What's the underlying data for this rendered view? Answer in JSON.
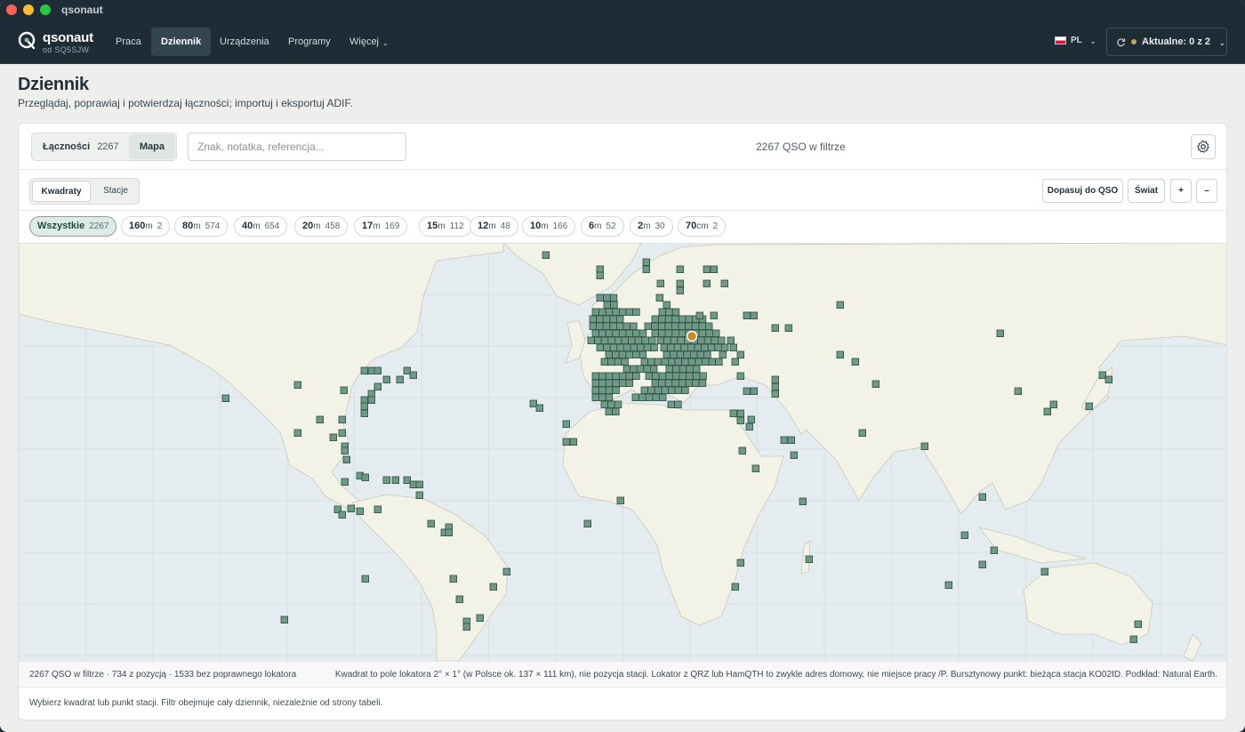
{
  "window": {
    "title": "qsonaut"
  },
  "brand": {
    "name": "qsonaut",
    "sub": "od SQ5SJW"
  },
  "nav": {
    "items": [
      "Praca",
      "Dziennik",
      "Urządzenia",
      "Programy",
      "Więcej"
    ],
    "active": "Dziennik"
  },
  "lang": "PL",
  "status": {
    "label": "Aktualne: 0 z 2"
  },
  "page": {
    "title": "Dziennik",
    "subtitle": "Przeglądaj, poprawiaj i potwierdzaj łączności; importuj i eksportuj ADIF."
  },
  "toolbar": {
    "tab_contacts": "Łączności",
    "tab_contacts_count": "2267",
    "tab_map": "Mapa",
    "search_placeholder": "Znak, notatka, referencja...",
    "filter_count": "2267 QSO w filtrze"
  },
  "map_controls": {
    "mode_squares": "Kwadraty",
    "mode_stations": "Stacje",
    "fit": "Dopasuj do QSO",
    "world": "Świat",
    "zoom_in": "+",
    "zoom_out": "–"
  },
  "bands": [
    {
      "label": "Wszystkie",
      "unit": "",
      "count": "2267",
      "active": true
    },
    {
      "label": "160",
      "unit": "m",
      "count": "2"
    },
    {
      "label": "80",
      "unit": "m",
      "count": "574"
    },
    {
      "label": "40",
      "unit": "m",
      "count": "654"
    },
    {
      "label": "20",
      "unit": "m",
      "count": "458"
    },
    {
      "label": "17",
      "unit": "m",
      "count": "169"
    },
    {
      "label": "15",
      "unit": "m",
      "count": "112"
    },
    {
      "label": "12",
      "unit": "m",
      "count": "48"
    },
    {
      "label": "10",
      "unit": "m",
      "count": "166"
    },
    {
      "label": "6",
      "unit": "m",
      "count": "52"
    },
    {
      "label": "2",
      "unit": "m",
      "count": "30"
    },
    {
      "label": "70",
      "unit": "cm",
      "count": "2"
    }
  ],
  "footer": {
    "summary": "2267 QSO w filtrze · 734 z pozycją · 1533 bez poprawnego lokatora",
    "note": "Kwadrat to pole lokatora 2° × 1° (w Polsce ok. 137 × 111 km), nie pozycja stacji. Lokator z QRZ lub HamQTH to zwykle adres domowy, nie miejsce pracy /P. Bursztynowy punkt: bieżąca stacja KO02ID. Podkład: Natural Earth.",
    "hint": "Wybierz kwadrat lub punkt stacji. Filtr obejmuje cały dziennik, niezależnie od strony tabeli."
  },
  "colors": {
    "nav_bg": "#1e2c35",
    "square_fill": "#6f9a87",
    "square_stroke": "#2f4d40",
    "land": "#f3f2e6",
    "sea": "#e5ecef",
    "station": "#c98a2e"
  }
}
